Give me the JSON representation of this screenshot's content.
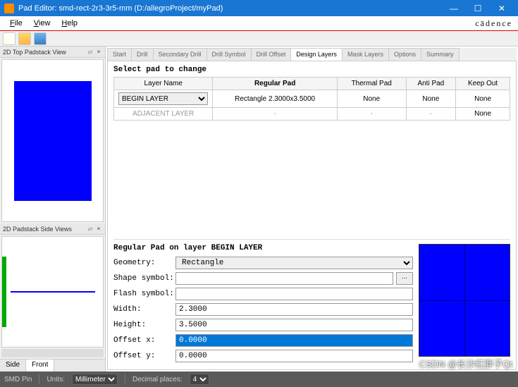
{
  "window": {
    "title": "Pad Editor: smd-rect-2r3-3r5-mm  (D:/allegroProject/myPad)",
    "brand": "cādence"
  },
  "menu": {
    "file": "File",
    "view": "View",
    "help": "Help"
  },
  "docks": {
    "top": "2D Top Padstack View",
    "side": "2D Padstack Side Views"
  },
  "tabs": {
    "start": "Start",
    "drill": "Drill",
    "secondary": "Secondary Drill",
    "symbol": "Drill Symbol",
    "offset": "Drill Offset",
    "design": "Design Layers",
    "mask": "Mask Layers",
    "options": "Options",
    "summary": "Summary"
  },
  "section": {
    "title": "Select pad to change"
  },
  "table": {
    "headers": {
      "layer": "Layer Name",
      "regular": "Regular Pad",
      "thermal": "Thermal Pad",
      "anti": "Anti Pad",
      "keepout": "Keep Out"
    },
    "row1": {
      "layer": "BEGIN LAYER",
      "regular": "Rectangle 2.3000x3.5000",
      "thermal": "None",
      "anti": "None",
      "keepout": "None"
    },
    "row2": {
      "layer": "ADJACENT LAYER",
      "regular": "-",
      "thermal": "-",
      "anti": "-",
      "keepout": "None"
    }
  },
  "form": {
    "title": "Regular Pad on layer BEGIN LAYER",
    "geometry_label": "Geometry:",
    "geometry_value": "Rectangle",
    "shape_label": "Shape symbol:",
    "shape_value": "",
    "flash_label": "Flash symbol:",
    "flash_value": "",
    "width_label": "Width:",
    "width_value": "2.3000",
    "height_label": "Height:",
    "height_value": "3.5000",
    "offsetx_label": "Offset x:",
    "offsetx_value": "0.0000",
    "offsety_label": "Offset y:",
    "offsety_value": "0.0000",
    "browse": "..."
  },
  "bottom_tabs": {
    "side": "Side",
    "front": "Front"
  },
  "status": {
    "type": "SMD Pin",
    "units_label": "Units:",
    "units_value": "Millimeter",
    "decimal_label": "Decimal places:",
    "decimal_value": "4"
  },
  "watermark": "CSDN @长沙红胖子Qt"
}
